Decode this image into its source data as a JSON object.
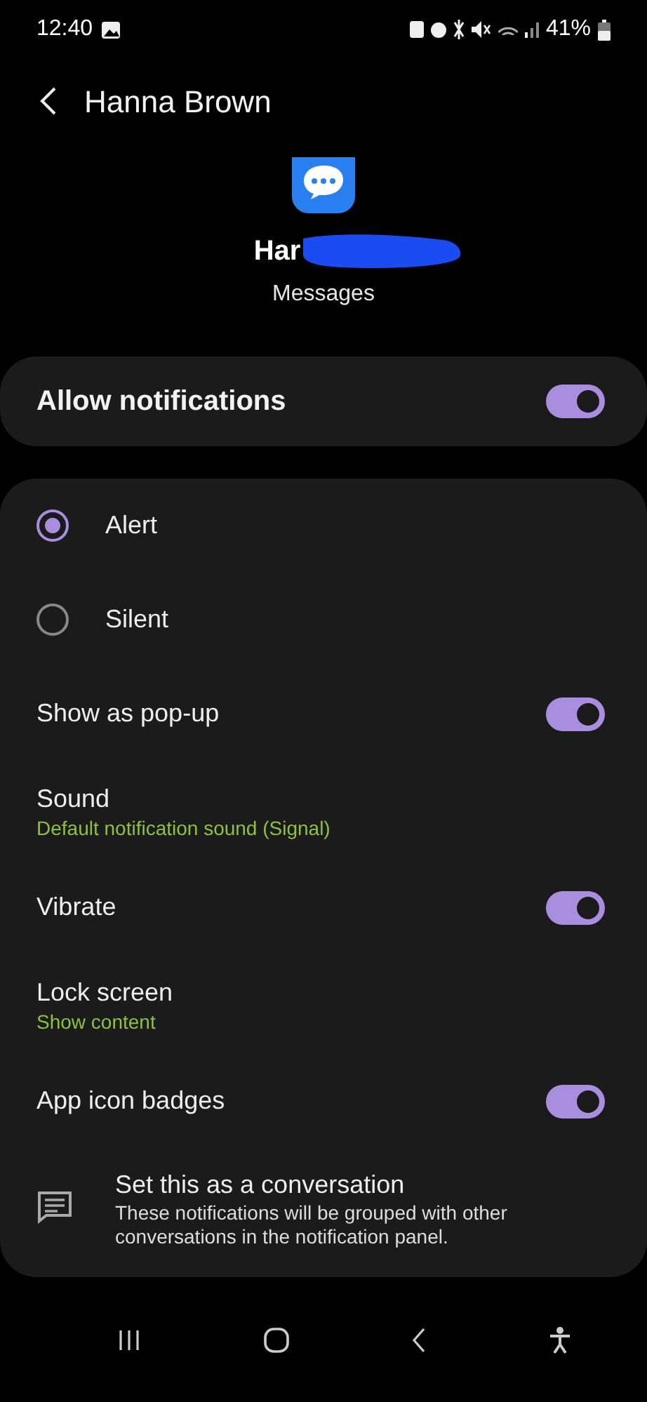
{
  "status_bar": {
    "time": "12:40",
    "battery": "41%"
  },
  "header": {
    "title": "Hanna Brown"
  },
  "app": {
    "name": "Har",
    "subtitle": "Messages"
  },
  "allow_notifications": {
    "label": "Allow notifications",
    "on": true
  },
  "settings": [
    {
      "kind": "radio",
      "label": "Alert",
      "selected": true
    },
    {
      "kind": "radio",
      "label": "Silent",
      "selected": false
    },
    {
      "kind": "toggle",
      "label": "Show as pop-up",
      "on": true
    },
    {
      "kind": "link",
      "label": "Sound",
      "value": "Default notification sound (Signal)"
    },
    {
      "kind": "toggle",
      "label": "Vibrate",
      "on": true
    },
    {
      "kind": "link",
      "label": "Lock screen",
      "value": "Show content"
    },
    {
      "kind": "toggle",
      "label": "App icon badges",
      "on": true
    },
    {
      "kind": "conversation",
      "label": "Set this as a conversation",
      "description": "These notifications will be grouped with other conversations in the notification panel."
    }
  ]
}
